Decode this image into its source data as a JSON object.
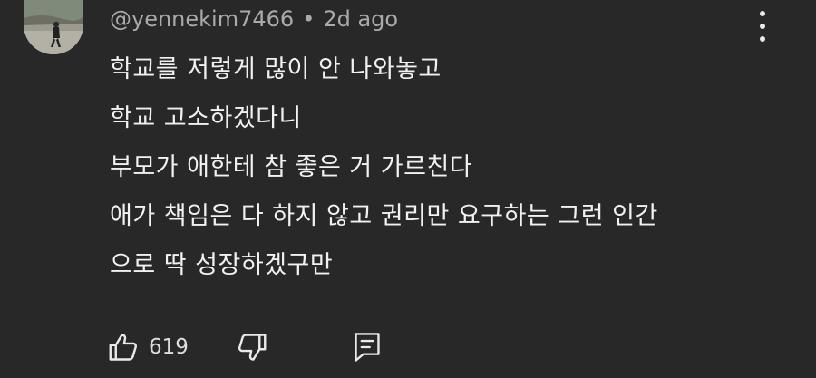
{
  "comment": {
    "author": "@yennekim7466",
    "separator": "•",
    "timestamp": "2d ago",
    "lines": [
      "학교를 저렇게 많이 안 나와놓고",
      "학교 고소하겠다니",
      "부모가 애한테 참 좋은 거 가르친다",
      "애가 책임은 다 하지 않고 권리만 요구하는 그런 인간",
      "으로 딱 성장하겠구만"
    ],
    "like_count": "619"
  },
  "icons": {
    "avatar": "profile-photo",
    "menu": "more-vert-icon",
    "like": "thumbs-up-icon",
    "dislike": "thumbs-down-icon",
    "reply": "reply-comment-icon"
  },
  "colors": {
    "background": "#282828",
    "text": "#f1f1f1",
    "meta": "#aaaaaa"
  }
}
